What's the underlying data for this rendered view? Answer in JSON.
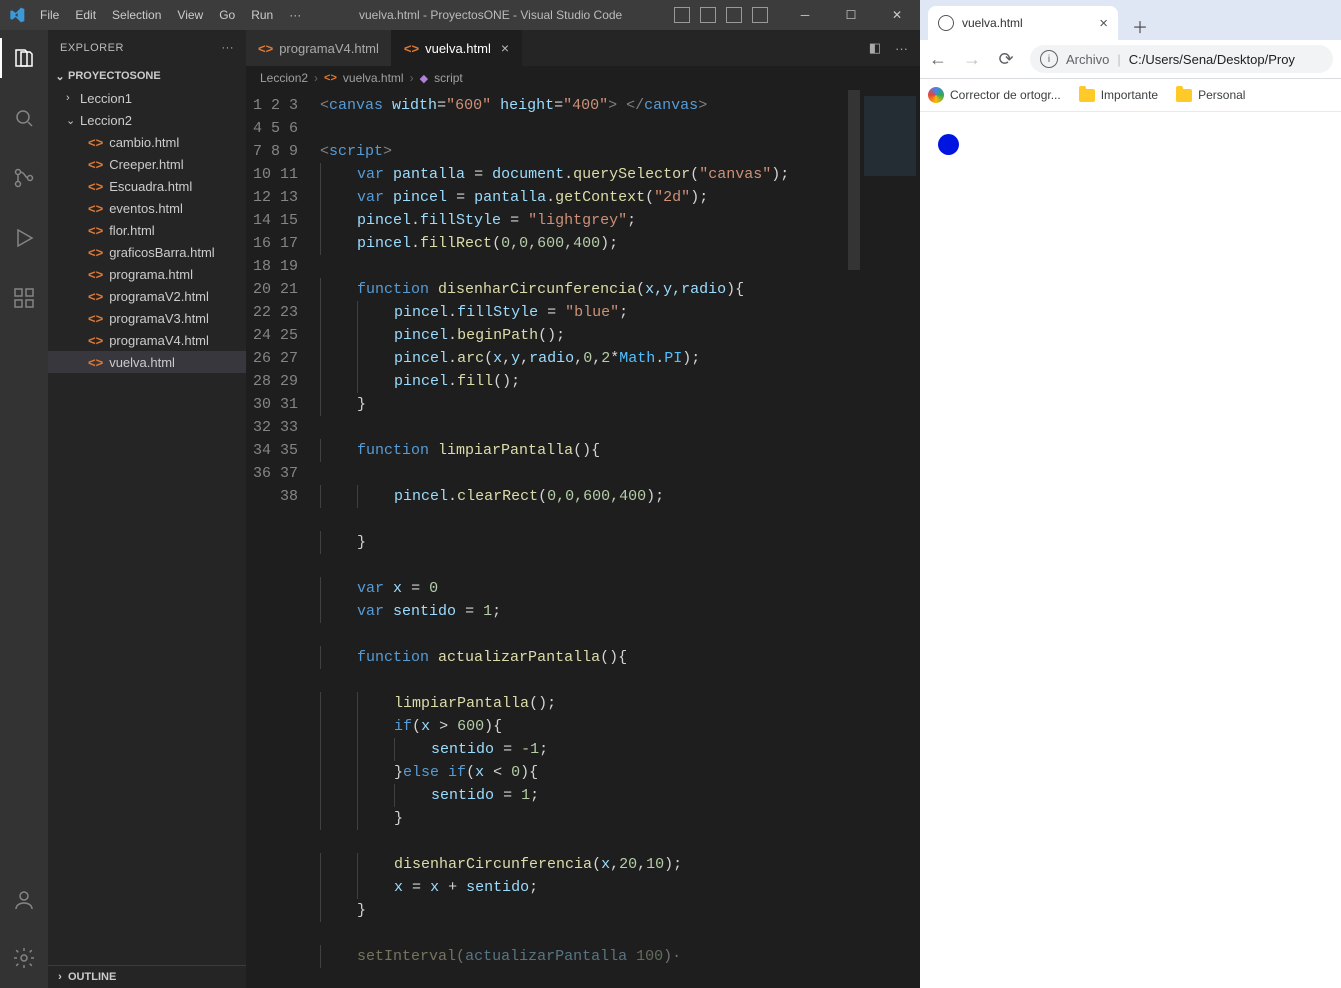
{
  "titlebar": {
    "menu": [
      "File",
      "Edit",
      "Selection",
      "View",
      "Go",
      "Run",
      "···"
    ],
    "title": "vuelva.html - ProyectosONE - Visual Studio Code"
  },
  "sidebar": {
    "panel_title": "EXPLORER",
    "project": "PROYECTOSONE",
    "folders": [
      {
        "name": "Leccion1",
        "open": false
      },
      {
        "name": "Leccion2",
        "open": true
      }
    ],
    "files": [
      "cambio.html",
      "Creeper.html",
      "Escuadra.html",
      "eventos.html",
      "flor.html",
      "graficosBarra.html",
      "programa.html",
      "programaV2.html",
      "programaV3.html",
      "programaV4.html",
      "vuelva.html"
    ],
    "selected_file": "vuelva.html",
    "outline": "OUTLINE"
  },
  "tabs": [
    {
      "label": "programaV4.html",
      "active": false
    },
    {
      "label": "vuelva.html",
      "active": true
    }
  ],
  "breadcrumbs": [
    "Leccion2",
    "vuelva.html",
    "script"
  ],
  "line_count": 38,
  "code": {
    "l1": {
      "tag": "canvas",
      "attrs": [
        [
          "width",
          "600"
        ],
        [
          "height",
          "400"
        ]
      ]
    },
    "l3": {
      "open": "script"
    },
    "l4": {
      "kw": "var",
      "name": "pantalla",
      "eq": "=",
      "obj": "document",
      "call": "querySelector",
      "arg": "\"canvas\""
    },
    "l5": {
      "kw": "var",
      "name": "pincel",
      "eq": "=",
      "obj": "pantalla",
      "call": "getContext",
      "arg": "\"2d\""
    },
    "l6": {
      "obj": "pincel",
      "prop": "fillStyle",
      "eq": "=",
      "val": "\"lightgrey\""
    },
    "l7": {
      "obj": "pincel",
      "call": "fillRect",
      "args": "0,0,600,400"
    },
    "l9": {
      "kw": "function",
      "fn": "disenharCircunferencia",
      "params": "x,y,radio"
    },
    "l10": {
      "obj": "pincel",
      "prop": "fillStyle",
      "eq": "=",
      "val": "\"blue\""
    },
    "l11": {
      "obj": "pincel",
      "call": "beginPath"
    },
    "l12": {
      "obj": "pincel",
      "call": "arc",
      "args": "x,y,radio,0,2*Math.PI"
    },
    "l13": {
      "obj": "pincel",
      "call": "fill"
    },
    "l16": {
      "kw": "function",
      "fn": "limpiarPantalla"
    },
    "l18": {
      "obj": "pincel",
      "call": "clearRect",
      "args": "0,0,600,400"
    },
    "l22": {
      "kw": "var",
      "name": "x",
      "eq": "=",
      "val": "0"
    },
    "l23": {
      "kw": "var",
      "name": "sentido",
      "eq": "=",
      "val": "1"
    },
    "l25": {
      "kw": "function",
      "fn": "actualizarPantalla"
    },
    "l27": {
      "call": "limpiarPantalla"
    },
    "l28": {
      "kw": "if",
      "cond": "x > 600"
    },
    "l29": {
      "assign": "sentido",
      "val": "-1"
    },
    "l30": {
      "else": "else if",
      "cond": "x < 0"
    },
    "l31": {
      "assign": "sentido",
      "val": "1"
    },
    "l34": {
      "call": "disenharCircunferencia",
      "args": "x,20,10"
    },
    "l35": {
      "assign": "x",
      "rhs": "x + sentido"
    },
    "l38": {
      "call": "setInterval",
      "partial": "actualizarPantalla 100"
    }
  },
  "chrome": {
    "tab_title": "vuelva.html",
    "addr_label": "Archivo",
    "addr_path": "C:/Users/Sena/Desktop/Proy",
    "bookmarks": [
      {
        "icon": "swirl",
        "label": "Corrector de ortogr..."
      },
      {
        "icon": "folder",
        "label": "Importante"
      },
      {
        "icon": "folder",
        "label": "Personal"
      }
    ]
  }
}
